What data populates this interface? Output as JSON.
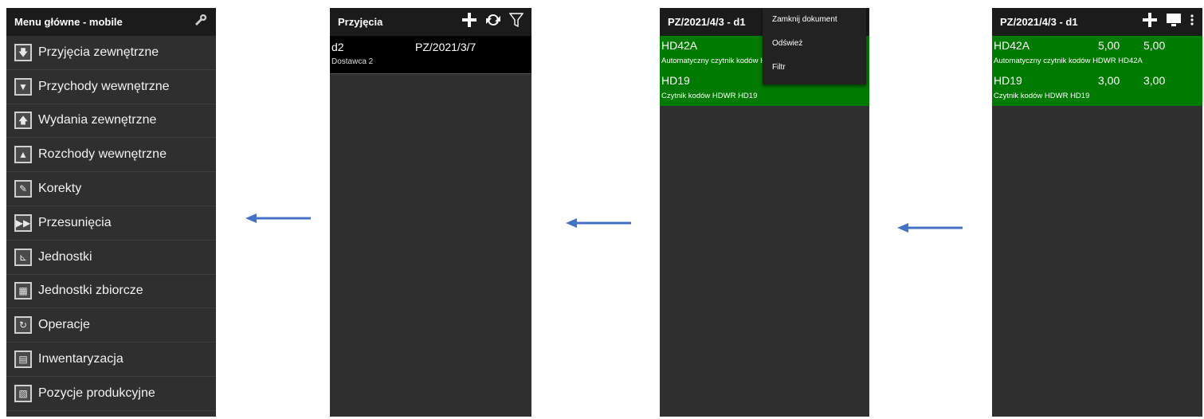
{
  "screen1": {
    "title": "Menu główne - mobile",
    "items": [
      {
        "label": "Przyjęcia zewnętrzne",
        "icon": "down-arrow-icon"
      },
      {
        "label": "Przychody wewnętrzne",
        "icon": "down-arrow-icon"
      },
      {
        "label": "Wydania zewnętrzne",
        "icon": "up-arrow-icon"
      },
      {
        "label": "Rozchody wewnętrzne",
        "icon": "up-arrow-icon"
      },
      {
        "label": "Korekty",
        "icon": "pencil-icon"
      },
      {
        "label": "Przesunięcia",
        "icon": "fast-forward-icon"
      },
      {
        "label": "Jednostki",
        "icon": "cart-icon"
      },
      {
        "label": "Jednostki zbiorcze",
        "icon": "pallet-icon"
      },
      {
        "label": "Operacje",
        "icon": "refresh-icon"
      },
      {
        "label": "Inwentaryzacja",
        "icon": "calculator-icon"
      },
      {
        "label": "Pozycje produkcyjne",
        "icon": "document-icon"
      }
    ]
  },
  "screen2": {
    "title": "Przyjęcia",
    "row": {
      "code": "d2",
      "doc": "PZ/2021/3/7",
      "supplier": "Dostawca 2"
    }
  },
  "screen3": {
    "title": "PZ/2021/4/3 - d1",
    "menu": [
      "Zamknij dokument",
      "Odśwież",
      "Filtr"
    ],
    "rows": [
      {
        "code": "HD42A",
        "name": "Automatyczny czytnik kodów HDWR HD42A"
      },
      {
        "code": "HD19",
        "name": "Czytnik kodów HDWR HD19"
      }
    ]
  },
  "screen4": {
    "title": "PZ/2021/4/3 - d1",
    "rows": [
      {
        "code": "HD42A",
        "q1": "5,00",
        "q2": "5,00",
        "name": "Automatyczny czytnik kodów HDWR HD42A"
      },
      {
        "code": "HD19",
        "q1": "3,00",
        "q2": "3,00",
        "name": "Czytnik kodów HDWR HD19"
      }
    ]
  },
  "colors": {
    "accent_green": "#007a00",
    "arrow_blue": "#4472c4"
  }
}
